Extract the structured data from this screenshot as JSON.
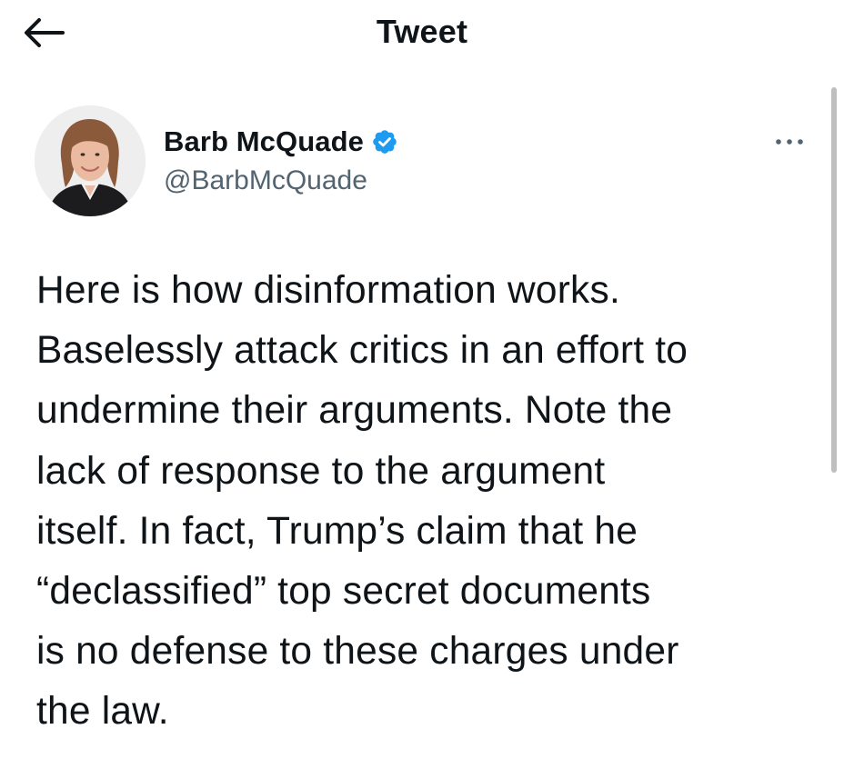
{
  "header": {
    "title": "Tweet",
    "back_icon": "arrow-left-icon"
  },
  "author": {
    "display_name": "Barb McQuade",
    "handle": "@BarbMcQuade",
    "verified": true,
    "verified_icon": "verified-badge-icon",
    "badge_color": "#1d9bf0"
  },
  "more_icon": "more-horizontal-icon",
  "tweet": {
    "text_lines": [
      "Here is how disinformation works.",
      "Baselessly attack critics in an effort to",
      "undermine their arguments. Note the",
      "lack of response to the argument",
      "itself. In fact, Trump’s claim that he",
      "“declassified” top secret documents",
      "is no defense to these charges under",
      "the law."
    ]
  },
  "colors": {
    "text": "#0f1419",
    "secondary_text": "#536471",
    "accent": "#1d9bf0",
    "background": "#ffffff"
  }
}
